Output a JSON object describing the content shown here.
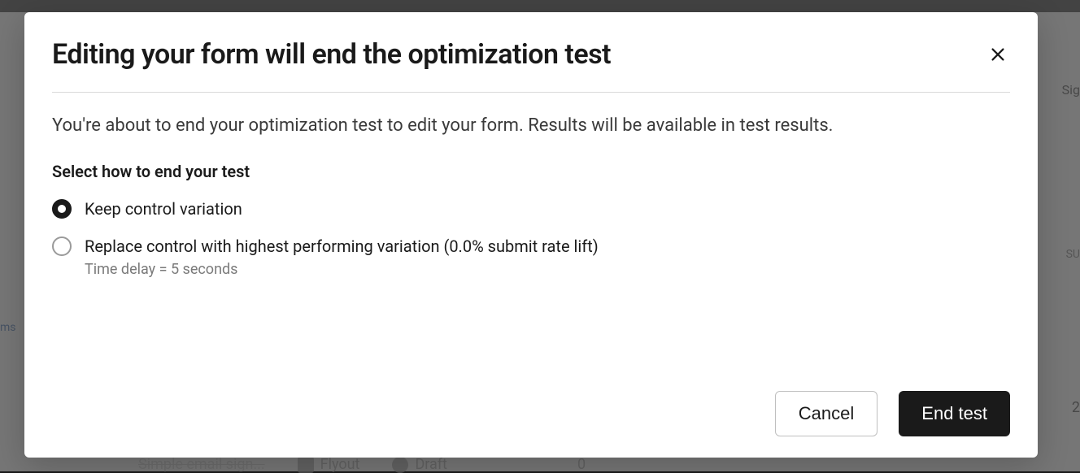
{
  "modal": {
    "title": "Editing your form will end the optimization test",
    "description": "You're about to end your optimization test to edit your form. Results will be available in test results.",
    "section_label": "Select how to end your test",
    "options": [
      {
        "label": "Keep control variation",
        "selected": true
      },
      {
        "label": "Replace control with highest performing variation (0.0% submit rate lift)",
        "sublabel": "Time delay = 5 seconds",
        "selected": false
      }
    ],
    "cancel_label": "Cancel",
    "confirm_label": "End test"
  },
  "background": {
    "top_right": "Sig",
    "mid_right": "SU",
    "left_tab": "ms",
    "count_right": "2",
    "bottom_items": [
      "Simple email sign...",
      "Flyout",
      "Draft",
      "0"
    ]
  }
}
